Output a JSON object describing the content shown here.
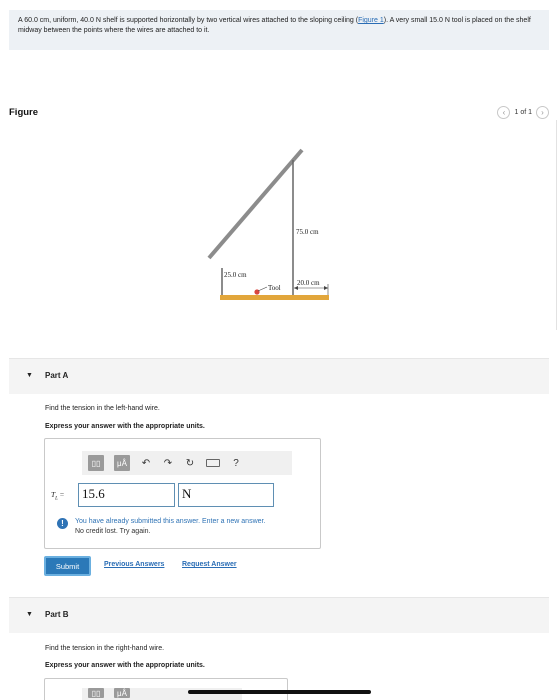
{
  "problem": {
    "text_before_link": "A 60.0 cm, uniform, 40.0 N shelf is supported horizontally by two vertical wires attached to the sloping ceiling (",
    "link": "Figure 1",
    "text_after_link": "). A very small 15.0 N tool is placed on the shelf midway between the points where the wires are attached to it."
  },
  "figure_header": {
    "title": "Figure",
    "counter": "1 of 1",
    "prev_icon": "chevron-left-icon",
    "next_icon": "chevron-right-icon"
  },
  "figure": {
    "label_right_wire": "75.0 cm",
    "label_left_wire": "25.0 cm",
    "label_offset": "20.0 cm",
    "label_tool": "Tool",
    "colors": {
      "shelf": "#e2a63b",
      "ceiling": "#8c8c8c",
      "tool": "#d9463e",
      "wire": "#666666"
    }
  },
  "part_a": {
    "caret": "▼",
    "label": "Part A",
    "question": "Find the tension in the left-hand wire.",
    "instruction": "Express your answer with the appropriate units.",
    "toolbar": {
      "templates": "▯▯",
      "units": "μÅ",
      "undo": "↶",
      "redo": "↷",
      "reset": "↻",
      "keyboard": "⌨",
      "help": "?"
    },
    "variable": "T",
    "variable_sub": "L",
    "equals": " =",
    "value": "15.6",
    "unit": "N",
    "warning_line1": "You have already submitted this answer. Enter a new answer.",
    "warning_line2": "No credit lost. Try again.",
    "submit": "Submit",
    "previous_answers": "Previous Answers",
    "request_answer": "Request Answer"
  },
  "part_b": {
    "caret": "▼",
    "label": "Part B",
    "question": "Find the tension in the right-hand wire.",
    "instruction": "Express your answer with the appropriate units.",
    "toolbar": {
      "templates": "▯▯",
      "units": "μÅ"
    }
  }
}
